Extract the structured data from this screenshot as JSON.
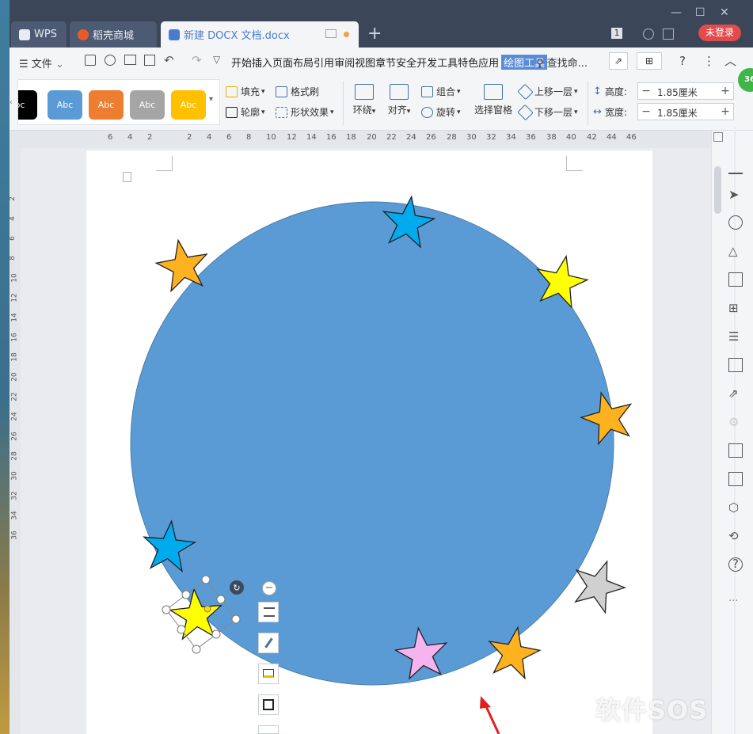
{
  "tabs": {
    "wps": "WPS",
    "store": "稻壳商城",
    "doc": "新建 DOCX 文档.docx",
    "badge": "1",
    "login": "未登录"
  },
  "menu": {
    "file": "文件",
    "items": [
      "开始",
      "插入",
      "页面布局",
      "引用",
      "审阅",
      "视图",
      "章节",
      "安全",
      "开发工具",
      "特色应用"
    ],
    "active": "绘图工具",
    "search": "查找命..."
  },
  "ribbon": {
    "styles": [
      "bc",
      "Abc",
      "Abc",
      "Abc",
      "Abc"
    ],
    "style_colors": [
      "#000000",
      "#5b9bd5",
      "#ed7d31",
      "#a5a5a5",
      "#ffc000"
    ],
    "fill": "填充",
    "format_painter": "格式刷",
    "outline": "轮廓",
    "shape_effect": "形状效果",
    "wrap": "环绕",
    "align": "对齐",
    "group": "组合",
    "rotate": "旋转",
    "select_pane": "选择窗格",
    "bring_forward": "上移一层",
    "send_backward": "下移一层",
    "height_label": "高度:",
    "width_label": "宽度:",
    "height_value": "1.85厘米",
    "width_value": "1.85厘米",
    "badge": "36"
  },
  "ruler": {
    "h": [
      "6",
      "4",
      "2",
      "2",
      "4",
      "6",
      "8",
      "10",
      "12",
      "14",
      "16",
      "18",
      "20",
      "22",
      "24",
      "26",
      "28",
      "30",
      "32",
      "34",
      "36",
      "38",
      "40",
      "42",
      "44",
      "46"
    ],
    "v": [
      "2",
      "4",
      "6",
      "8",
      "10",
      "12",
      "14",
      "16",
      "18",
      "20",
      "22",
      "24",
      "26",
      "28",
      "30",
      "32",
      "34",
      "36"
    ]
  },
  "canvas": {
    "circle_color": "#5b9bd5",
    "stars": [
      {
        "name": "star-orange-topleft",
        "color": "#ffb21f"
      },
      {
        "name": "star-blue-top",
        "color": "#00aaee"
      },
      {
        "name": "star-yellow-topright",
        "color": "#ffff00"
      },
      {
        "name": "star-orange-right",
        "color": "#ffb21f"
      },
      {
        "name": "star-gray-right",
        "color": "#d0d0d0"
      },
      {
        "name": "star-orange-bottomright",
        "color": "#ffb21f"
      },
      {
        "name": "star-pink-bottom",
        "color": "#f5b4f0"
      },
      {
        "name": "star-blue-left",
        "color": "#00aaee"
      },
      {
        "name": "star-yellow-selected",
        "color": "#ffff00"
      }
    ]
  },
  "watermark": "软件SOS"
}
